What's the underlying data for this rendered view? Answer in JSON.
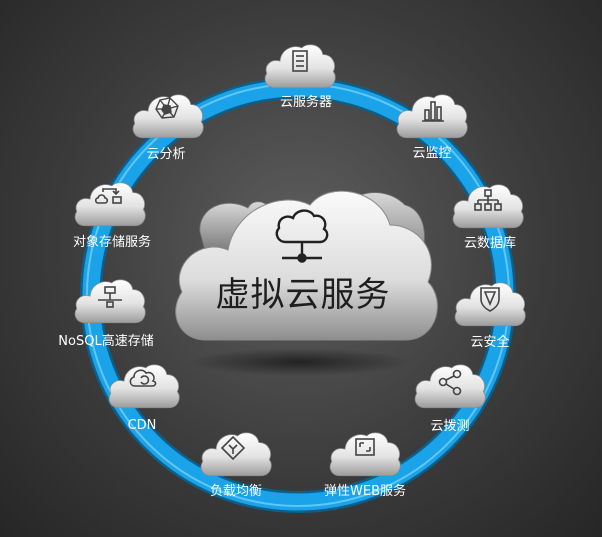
{
  "center": {
    "title": "虚拟云服务",
    "icon": "network-cloud-icon"
  },
  "colors": {
    "ring": "#1aa3e8",
    "ring_highlight": "#7fd6ff",
    "cloud_light": "#f4f4f4",
    "cloud_dark": "#9a9a9a"
  },
  "services": [
    {
      "label": "云服务器",
      "icon": "server-icon"
    },
    {
      "label": "云监控",
      "icon": "bar-chart-icon"
    },
    {
      "label": "云数据库",
      "icon": "hierarchy-icon"
    },
    {
      "label": "云安全",
      "icon": "shield-icon"
    },
    {
      "label": "云拨测",
      "icon": "share-icon"
    },
    {
      "label": "弹性WEB服务",
      "icon": "resize-icon"
    },
    {
      "label": "负载均衡",
      "icon": "load-balance-icon"
    },
    {
      "label": "CDN",
      "icon": "refresh-cloud-icon"
    },
    {
      "label": "NoSQL高速存储",
      "icon": "network-node-icon"
    },
    {
      "label": "对象存储服务",
      "icon": "object-flow-icon"
    },
    {
      "label": "云分析",
      "icon": "radar-icon"
    }
  ]
}
